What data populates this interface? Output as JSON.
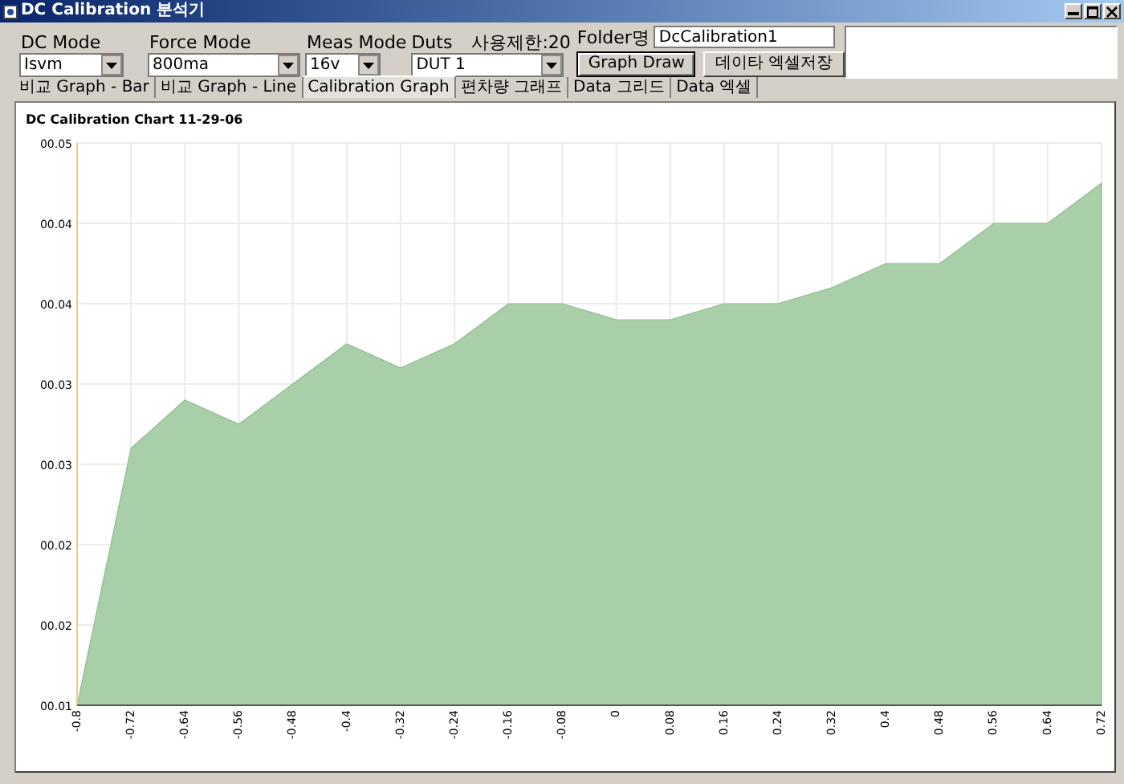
{
  "window": {
    "title": "DC Calibration 분석기"
  },
  "selectors": [
    {
      "label": "DC Mode",
      "value": "Isvm"
    },
    {
      "label": "Force Mode",
      "value": "800ma"
    },
    {
      "label": "Meas Mode",
      "value": "16v"
    },
    {
      "label": "Duts",
      "value": "DUT 1"
    }
  ],
  "usage_limit": "사용제한:20",
  "folder": {
    "label": "Folder명",
    "value": "DcCalibration1"
  },
  "buttons": [
    {
      "label": "Graph Draw",
      "default": true
    },
    {
      "label": "데이타 엑셀저장",
      "default": false
    }
  ],
  "tabs": [
    {
      "label": "비교 Graph - Bar",
      "selected": false
    },
    {
      "label": "비교 Graph - Line",
      "selected": false
    },
    {
      "label": "Calibration Graph",
      "selected": true
    },
    {
      "label": "편차량 그래프",
      "selected": false
    },
    {
      "label": "Data 그리드",
      "selected": false
    },
    {
      "label": "Data 엑셀",
      "selected": false
    }
  ],
  "chart_data": {
    "type": "area",
    "title": "DC Calibration Chart 11-29-06",
    "categories": [
      "-0.8",
      "-0.72",
      "-0.64",
      "-0.56",
      "-0.48",
      "-0.4",
      "-0.32",
      "-0.24",
      "-0.16",
      "-0.08",
      "0",
      "0.08",
      "0.16",
      "0.24",
      "0.32",
      "0.4",
      "0.48",
      "0.56",
      "0.64",
      "0.72"
    ],
    "series": [
      {
        "color": "#a8cfa8",
        "values": [
          0.01,
          0.026,
          0.029,
          0.0275,
          0.03,
          0.0325,
          0.031,
          0.0325,
          0.035,
          0.035,
          0.034,
          0.034,
          0.035,
          0.035,
          0.036,
          0.0375,
          0.0375,
          0.04,
          0.04,
          0.0425
        ]
      }
    ],
    "grid": true,
    "ylim": [
      0.01,
      0.045
    ],
    "yticks": [
      {
        "value": 0.01,
        "label": "00.01"
      },
      {
        "value": 0.015,
        "label": "00.02"
      },
      {
        "value": 0.02,
        "label": "00.02"
      },
      {
        "value": 0.025,
        "label": "00.03"
      },
      {
        "value": 0.03,
        "label": "00.03"
      },
      {
        "value": 0.035,
        "label": "00.04"
      },
      {
        "value": 0.04,
        "label": "00.04"
      },
      {
        "value": 0.045,
        "label": "00.05"
      }
    ]
  }
}
